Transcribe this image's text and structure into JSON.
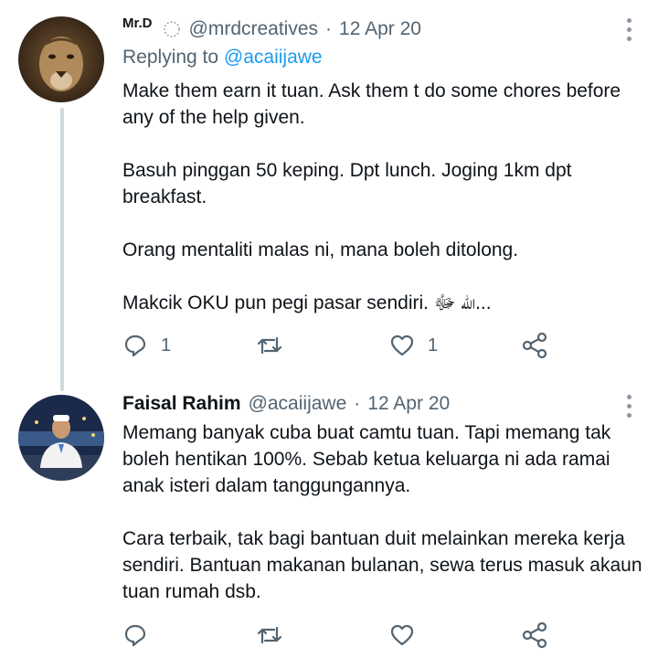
{
  "tweets": [
    {
      "display_name": "Mr.D",
      "badge_icon": "dotted-circle-icon",
      "handle": "@mrdcreatives",
      "separator": "·",
      "date": "12 Apr 20",
      "replying_prefix": "Replying to",
      "replying_handle": "@acaiijawe",
      "paragraphs": [
        "Make them earn it tuan. Ask them t do some chores before any of the help given.",
        "Basuh pinggan 50 keping. Dpt lunch. Joging 1km dpt breakfast.",
        "Orang mentaliti malas ni, mana boleh ditolong.",
        "Makcik OKU pun pegi pasar sendiri. الله ﷻ..."
      ],
      "reply_count": "1",
      "retweet_count": "",
      "like_count": "1"
    },
    {
      "display_name": "Faisal Rahim",
      "handle": "@acaiijawe",
      "separator": "·",
      "date": "12 Apr 20",
      "paragraphs": [
        "Memang banyak cuba buat camtu tuan. Tapi memang tak boleh hentikan 100%. Sebab ketua keluarga ni ada ramai anak isteri dalam tanggungannya.",
        "Cara terbaik, tak bagi bantuan duit melainkan mereka kerja sendiri. Bantuan makanan bulanan, sewa terus masuk akaun tuan rumah dsb."
      ],
      "reply_count": "",
      "retweet_count": "",
      "like_count": ""
    }
  ],
  "icons": {
    "reply": "speech-bubble-icon",
    "retweet": "retweet-arrows-icon",
    "like": "heart-icon",
    "share": "share-icon",
    "more": "vertical-dots-icon"
  },
  "colors": {
    "text": "#0f1419",
    "secondary": "#536471",
    "link": "#1d9bf0",
    "thread_line": "#cfd9de"
  }
}
